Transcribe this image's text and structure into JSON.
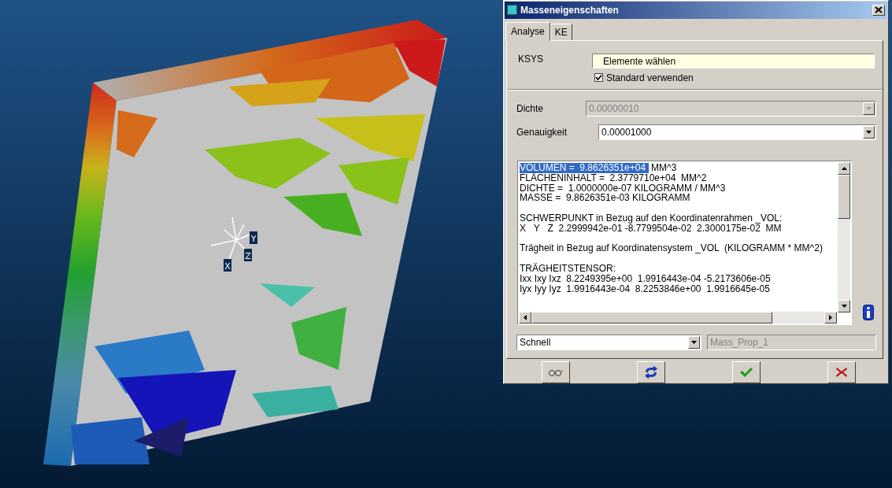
{
  "viewport": {
    "axis_labels": [
      "Y",
      "Z",
      "X"
    ]
  },
  "dialog": {
    "title": "Masseneigenschaften",
    "tabs": [
      {
        "label": "Analyse",
        "selected": true
      },
      {
        "label": "KE",
        "selected": false
      }
    ],
    "ksys": {
      "label": "KSYS",
      "field": {
        "value": "Elemente wählen"
      },
      "checkbox": {
        "label": "Standard verwenden",
        "checked": true
      }
    },
    "fields": [
      {
        "label": "Dichte",
        "value": "0.00000010",
        "disabled": true
      },
      {
        "label": "Genauigkeit",
        "value": "0.00001000",
        "disabled": false
      }
    ],
    "results": {
      "paragraphs": [
        [
          {
            "selected_text": "VOLUMEN =  9.8626351e+04",
            "text": "MM^3"
          },
          {
            "text": "FLÄCHENINHALT =  2.3779710e+04  MM^2"
          },
          {
            "text": "DICHTE =  1.0000000e-07 KILOGRAMM / MM^3"
          },
          {
            "text": "MASSE =  9.8626351e-03 KILOGRAMM"
          }
        ],
        [
          {
            "text": "SCHWERPUNKT in Bezug auf den Koordinatenrahmen _VOL:"
          },
          {
            "text": "X   Y   Z  2.2999942e-01 -8.7799504e-02  2.3000175e-02  MM"
          }
        ],
        [
          {
            "text": "Trägheit in Bezug auf Koordinatensystem _VOL  (KILOGRAMM * MM^2)"
          }
        ],
        [
          {
            "text": "TRÄGHEITSTENSOR:"
          },
          {
            "text": "Ixx Ixy Ixz  8.2249395e+00  1.9916443e-04 -5.2173606e-05"
          },
          {
            "text": "Iyx Iyy Iyz  1.9916443e-04  8.2253846e+00  1.9916645e-05"
          }
        ]
      ]
    },
    "method": {
      "value": "Schnell"
    },
    "name_field": {
      "value": "Mass_Prop_1",
      "disabled": true
    },
    "buttons": [
      {
        "kind": "preview"
      },
      {
        "kind": "repeat"
      },
      {
        "kind": "ok"
      },
      {
        "kind": "cancel"
      }
    ]
  }
}
